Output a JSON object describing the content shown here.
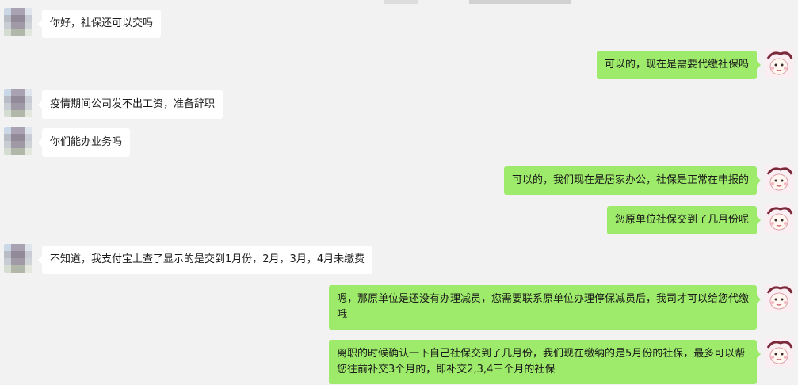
{
  "messages": [
    {
      "side": "left",
      "text": "你好，社保还可以交吗"
    },
    {
      "side": "right",
      "text": "可以的，现在是需要代缴社保吗"
    },
    {
      "side": "left",
      "text": "疫情期间公司发不出工资，准备辞职"
    },
    {
      "side": "left",
      "text": "你们能办业务吗"
    },
    {
      "side": "right",
      "text": "可以的，我们现在是居家办公，社保是正常在申报的"
    },
    {
      "side": "right",
      "text": "您原单位社保交到了几月份呢"
    },
    {
      "side": "left",
      "text": "不知道，我支付宝上查了显示的是交到1月份，2月，3月，4月未缴费"
    },
    {
      "side": "right",
      "text": "嗯，那原单位是还没有办理减员，您需要联系原单位办理停保减员后，我司才可以给您代缴哦"
    },
    {
      "side": "right",
      "text": "离职的时候确认一下自己社保交到了几月份，我们现在缴纳的是5月份的社保，最多可以帮您往前补交3个月的，即补交2,3,4三个月的社保"
    }
  ],
  "colors": {
    "background": "#f2f2f2",
    "incoming_bubble": "#ffffff",
    "outgoing_bubble": "#9eea6a"
  }
}
